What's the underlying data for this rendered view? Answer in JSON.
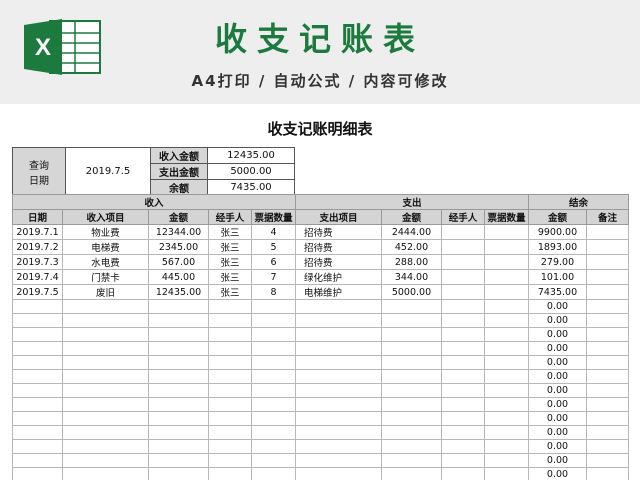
{
  "banner": {
    "title": "收支记账表",
    "subtitle": "A4打印 / 自动公式 / 内容可修改"
  },
  "sheet": {
    "title": "收支记账明细表",
    "query_label_1": "查询",
    "query_label_2": "日期",
    "query_date": "2019.7.5",
    "summary": [
      {
        "label": "收入金额",
        "value": "12435.00"
      },
      {
        "label": "支出金额",
        "value": "5000.00"
      },
      {
        "label": "余额",
        "value": "7435.00"
      }
    ],
    "group_headers": {
      "income": "收入",
      "expense": "支出",
      "balance": "结余"
    },
    "columns": [
      "日期",
      "收入项目",
      "金额",
      "经手人",
      "票据数量",
      "支出项目",
      "金额",
      "经手人",
      "票据数量",
      "金额",
      "备注"
    ],
    "rows": [
      [
        "2019.7.1",
        "物业费",
        "12344.00",
        "张三",
        "4",
        "招待费",
        "2444.00",
        "",
        "",
        "9900.00",
        ""
      ],
      [
        "2019.7.2",
        "电梯费",
        "2345.00",
        "张三",
        "5",
        "招待费",
        "452.00",
        "",
        "",
        "1893.00",
        ""
      ],
      [
        "2019.7.3",
        "水电费",
        "567.00",
        "张三",
        "6",
        "招待费",
        "288.00",
        "",
        "",
        "279.00",
        ""
      ],
      [
        "2019.7.4",
        "门禁卡",
        "445.00",
        "张三",
        "7",
        "绿化维护",
        "344.00",
        "",
        "",
        "101.00",
        ""
      ],
      [
        "2019.7.5",
        "废旧",
        "12435.00",
        "张三",
        "8",
        "电梯维护",
        "5000.00",
        "",
        "",
        "7435.00",
        ""
      ],
      [
        "",
        "",
        "",
        "",
        "",
        "",
        "",
        "",
        "",
        "0.00",
        ""
      ],
      [
        "",
        "",
        "",
        "",
        "",
        "",
        "",
        "",
        "",
        "0.00",
        ""
      ],
      [
        "",
        "",
        "",
        "",
        "",
        "",
        "",
        "",
        "",
        "0.00",
        ""
      ],
      [
        "",
        "",
        "",
        "",
        "",
        "",
        "",
        "",
        "",
        "0.00",
        ""
      ],
      [
        "",
        "",
        "",
        "",
        "",
        "",
        "",
        "",
        "",
        "0.00",
        ""
      ],
      [
        "",
        "",
        "",
        "",
        "",
        "",
        "",
        "",
        "",
        "0.00",
        ""
      ],
      [
        "",
        "",
        "",
        "",
        "",
        "",
        "",
        "",
        "",
        "0.00",
        ""
      ],
      [
        "",
        "",
        "",
        "",
        "",
        "",
        "",
        "",
        "",
        "0.00",
        ""
      ],
      [
        "",
        "",
        "",
        "",
        "",
        "",
        "",
        "",
        "",
        "0.00",
        ""
      ],
      [
        "",
        "",
        "",
        "",
        "",
        "",
        "",
        "",
        "",
        "0.00",
        ""
      ],
      [
        "",
        "",
        "",
        "",
        "",
        "",
        "",
        "",
        "",
        "0.00",
        ""
      ],
      [
        "",
        "",
        "",
        "",
        "",
        "",
        "",
        "",
        "",
        "0.00",
        ""
      ],
      [
        "",
        "",
        "",
        "",
        "",
        "",
        "",
        "",
        "",
        "0.00",
        ""
      ]
    ]
  },
  "colors": {
    "brand_green": "#1c7a3f",
    "header_gray": "#d4d4d4"
  },
  "icons": {
    "logo": "excel-logo-icon"
  }
}
